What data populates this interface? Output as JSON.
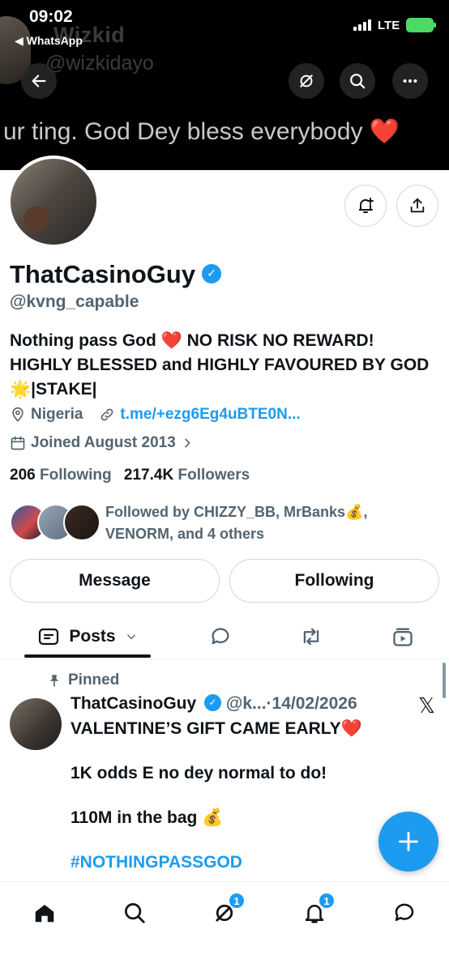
{
  "status_bar": {
    "time": "09:02",
    "back_app": "◀ WhatsApp",
    "network": "LTE"
  },
  "banner": {
    "name": "Wizkid",
    "handle": "@wizkidayo",
    "text": "ur ting. God Dey bless everybody",
    "heart": "❤️"
  },
  "profile": {
    "display_name": "ThatCasinoGuy",
    "handle": "@kvng_capable",
    "bio_line1": "Nothing pass God ❤️ NO RISK NO REWARD!",
    "bio_line2": "HIGHLY BLESSED and HIGHLY FAVOURED BY GOD",
    "bio_line3": "🌟|STAKE|",
    "location": "Nigeria",
    "link": "t.me/+ezg6Eg4uBTE0N...",
    "joined": "Joined August 2013",
    "following_count": "206",
    "following_label": "Following",
    "followers_count": "217.4K",
    "followers_label": "Followers",
    "followed_by_line1": "Followed by CHIZZY_BB, MrBanks💰,",
    "followed_by_line2": "VENORM, and 4 others"
  },
  "buttons": {
    "message": "Message",
    "following": "Following"
  },
  "tabs": {
    "posts": "Posts"
  },
  "post": {
    "pinned_label": "Pinned",
    "author": "ThatCasinoGuy",
    "meta": "@k...·14/02/2026",
    "line1": "VALENTINE’S GIFT CAME EARLY❤️",
    "line2": "1K odds E no dey normal to do!",
    "line3": "110M in the bag 💰",
    "hashtag": "#NOTHINGPASSGOD"
  },
  "nav": {
    "messages_badge": "1",
    "notifications_badge": "1"
  },
  "colors": {
    "accent": "#1d9bf0",
    "text_primary": "#0f1419",
    "text_secondary": "#536471"
  }
}
